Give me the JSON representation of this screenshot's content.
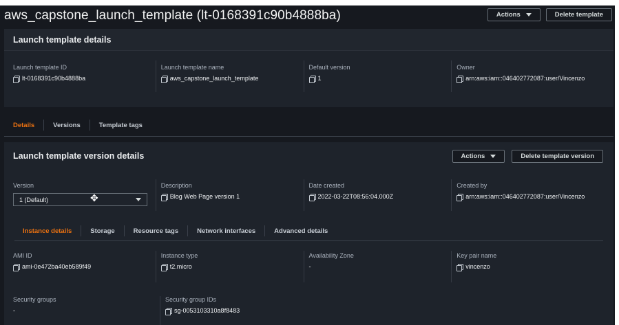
{
  "header": {
    "title": "aws_capstone_launch_template (lt-0168391c90b4888ba)",
    "actions_label": "Actions",
    "delete_label": "Delete template"
  },
  "template_details": {
    "title": "Launch template details",
    "fields": [
      {
        "label": "Launch template ID",
        "value": "lt-0168391c90b4888ba"
      },
      {
        "label": "Launch template name",
        "value": "aws_capstone_launch_template"
      },
      {
        "label": "Default version",
        "value": "1"
      },
      {
        "label": "Owner",
        "value": "arn:aws:iam::046402772087:user/Vincenzo"
      }
    ]
  },
  "tabs": [
    {
      "label": "Details",
      "active": true
    },
    {
      "label": "Versions",
      "active": false
    },
    {
      "label": "Template tags",
      "active": false
    }
  ],
  "version_details": {
    "title": "Launch template version details",
    "actions_label": "Actions",
    "delete_label": "Delete template version",
    "version_label": "Version",
    "version_value": "1 (Default)",
    "fields": [
      {
        "label": "Description",
        "value": "Blog Web Page version 1"
      },
      {
        "label": "Date created",
        "value": "2022-03-22T08:56:04.000Z"
      },
      {
        "label": "Created by",
        "value": "arn:aws:iam::046402772087:user/Vincenzo"
      }
    ]
  },
  "inner_tabs": [
    {
      "label": "Instance details",
      "active": true
    },
    {
      "label": "Storage",
      "active": false
    },
    {
      "label": "Resource tags",
      "active": false
    },
    {
      "label": "Network interfaces",
      "active": false
    },
    {
      "label": "Advanced details",
      "active": false
    }
  ],
  "instance_details": {
    "row1": [
      {
        "label": "AMI ID",
        "value": "ami-0e472ba40eb589f49"
      },
      {
        "label": "Instance type",
        "value": "t2.micro"
      },
      {
        "label": "Availability Zone",
        "value": "-"
      },
      {
        "label": "Key pair name",
        "value": "vincenzo"
      }
    ],
    "row2": [
      {
        "label": "Security groups",
        "value": "-"
      },
      {
        "label": "Security group IDs",
        "value": "sg-0053103310a8f8483"
      }
    ]
  },
  "colors": {
    "accent": "#ec7211",
    "background": "#16191f",
    "panel": "#1e232b"
  }
}
